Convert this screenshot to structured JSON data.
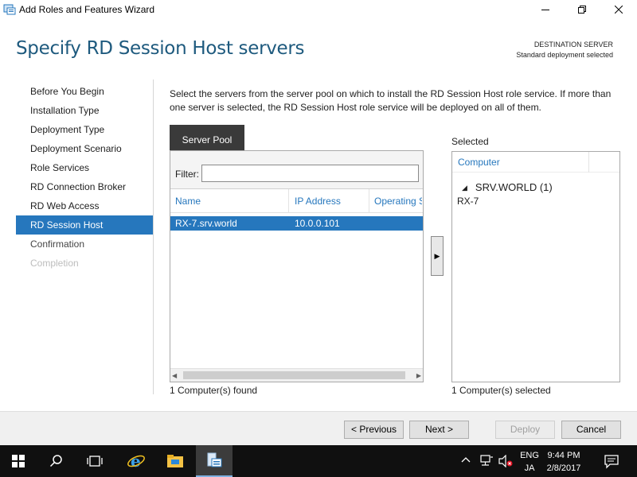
{
  "window": {
    "title": "Add Roles and Features Wizard"
  },
  "header": {
    "page_title": "Specify RD Session Host servers",
    "destination_label": "DESTINATION SERVER",
    "destination_value": "Standard deployment selected"
  },
  "nav": {
    "items": [
      {
        "label": "Before You Begin",
        "state": "done"
      },
      {
        "label": "Installation Type",
        "state": "done"
      },
      {
        "label": "Deployment Type",
        "state": "done"
      },
      {
        "label": "Deployment Scenario",
        "state": "done"
      },
      {
        "label": "Role Services",
        "state": "done"
      },
      {
        "label": "RD Connection Broker",
        "state": "done"
      },
      {
        "label": "RD Web Access",
        "state": "done"
      },
      {
        "label": "RD Session Host",
        "state": "active"
      },
      {
        "label": "Confirmation",
        "state": "pending"
      },
      {
        "label": "Completion",
        "state": "disabled"
      }
    ]
  },
  "content": {
    "description": "Select the servers from the server pool on which to install the RD Session Host role service. If more than one server is selected, the RD Session Host role service will be deployed on all of them.",
    "pool_tab": "Server Pool",
    "filter_label": "Filter:",
    "filter_value": "",
    "columns": [
      "Name",
      "IP Address",
      "Operating S"
    ],
    "rows": [
      {
        "name": "RX-7.srv.world",
        "ip": "10.0.0.101",
        "os": ""
      }
    ],
    "found": "1 Computer(s) found",
    "add_button": "▶",
    "selected_label": "Selected",
    "selected_column": "Computer",
    "selected_group": "SRV.WORLD (1)",
    "selected_items": [
      "RX-7"
    ],
    "selected_count": "1 Computer(s) selected"
  },
  "footer": {
    "previous": "< Previous",
    "next": "Next >",
    "deploy": "Deploy",
    "cancel": "Cancel"
  },
  "taskbar": {
    "lang_top": "ENG",
    "lang_bottom": "JA",
    "time": "9:44 PM",
    "date": "2/8/2017"
  },
  "colors": {
    "accent": "#2677bd",
    "title_blue": "#1e5a7e"
  }
}
